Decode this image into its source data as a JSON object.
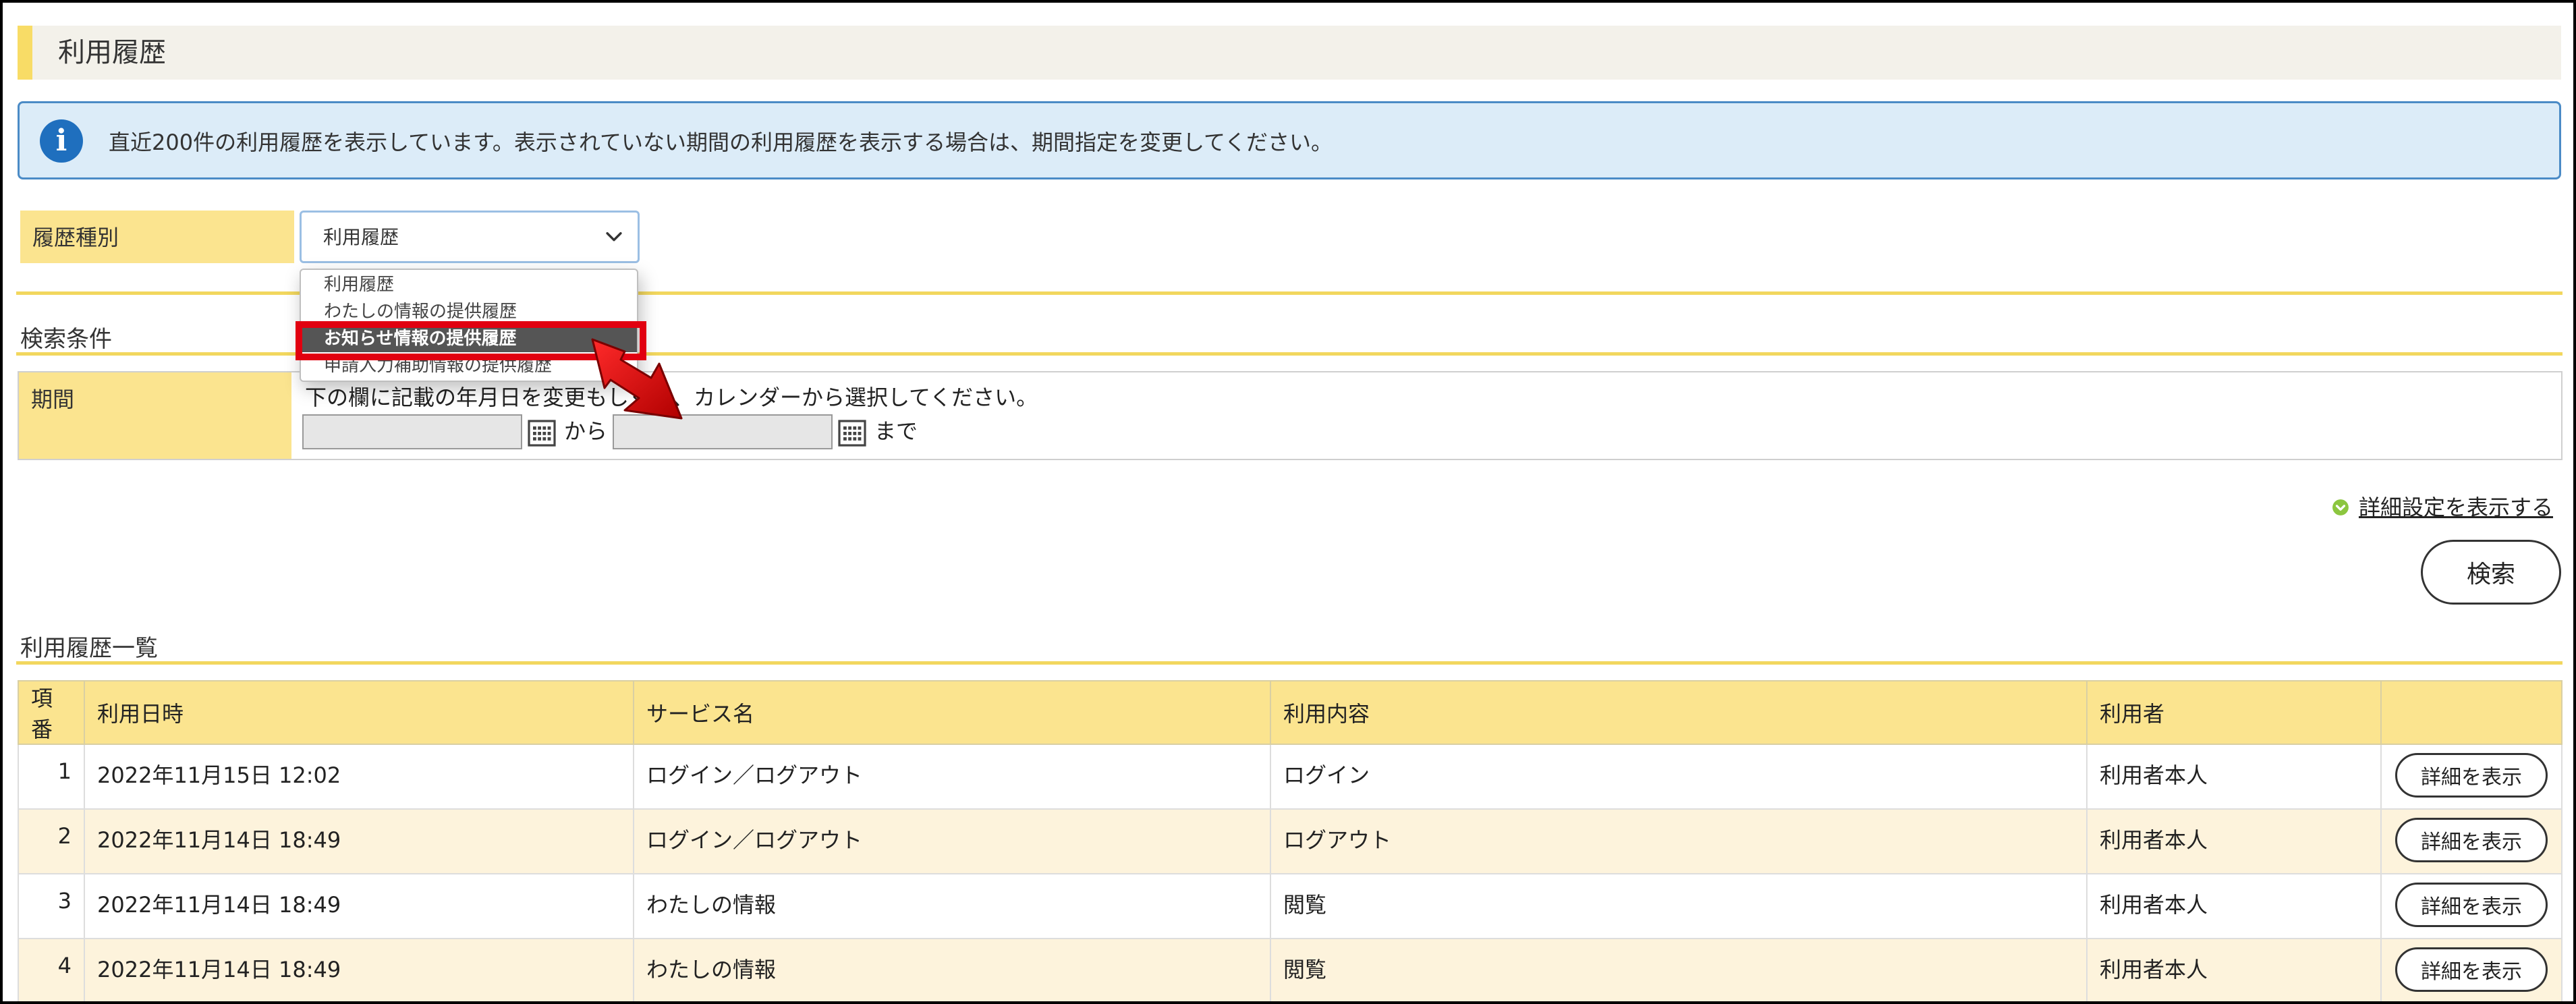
{
  "header": {
    "title": "利用履歴"
  },
  "info": {
    "icon": "info-icon",
    "icon_glyph": "i",
    "message": "直近200件の利用履歴を表示しています。表示されていない期間の利用履歴を表示する場合は、期間指定を変更してください。"
  },
  "history_type": {
    "label": "履歴種別",
    "selected": "利用履歴",
    "options": [
      "利用履歴",
      "わたしの情報の提供履歴",
      "お知らせ情報の提供履歴",
      "申請入力補助情報の提供履歴"
    ],
    "highlighted_option": "お知らせ情報の提供履歴"
  },
  "search_conditions": {
    "title": "検索条件",
    "period_label": "期間",
    "instruction": "下の欄に記載の年月日を変更もしくは、カレンダーから選択してください。",
    "from_value": "",
    "to_value": "",
    "from_text": "から",
    "to_text": "まで"
  },
  "advanced_link": "詳細設定を表示する",
  "search_button": "検索",
  "history_list": {
    "title": "利用履歴一覧",
    "columns": [
      "項番",
      "利用日時",
      "サービス名",
      "利用内容",
      "利用者",
      ""
    ],
    "detail_button_label": "詳細を表示",
    "rows": [
      {
        "no": "1",
        "datetime": "2022年11月15日 12:02",
        "service": "ログイン／ログアウト",
        "content": "ログイン",
        "user": "利用者本人"
      },
      {
        "no": "2",
        "datetime": "2022年11月14日 18:49",
        "service": "ログイン／ログアウト",
        "content": "ログアウト",
        "user": "利用者本人"
      },
      {
        "no": "3",
        "datetime": "2022年11月14日 18:49",
        "service": "わたしの情報",
        "content": "閲覧",
        "user": "利用者本人"
      },
      {
        "no": "4",
        "datetime": "2022年11月14日 18:49",
        "service": "わたしの情報",
        "content": "閲覧",
        "user": "利用者本人"
      }
    ]
  },
  "colors": {
    "accent_yellow": "#fbe48f",
    "info_border": "#4b8bc6",
    "info_bg": "#dcecf8",
    "highlight_red": "#e10010",
    "selected_option_bg": "#555555"
  }
}
